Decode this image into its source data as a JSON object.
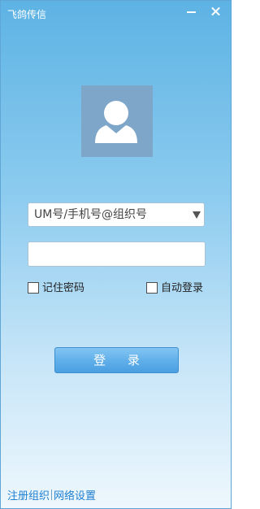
{
  "window": {
    "title": "飞鸽传信"
  },
  "login": {
    "account_placeholder": "UM号/手机号@组织号",
    "password_value": "",
    "remember_password_label": "记住密码",
    "remember_password_checked": false,
    "auto_login_label": "自动登录",
    "auto_login_checked": false,
    "login_button_label": "登 录"
  },
  "footer": {
    "register_link": "注册组织",
    "network_link": "网络设置"
  },
  "colors": {
    "gradient_top": "#5db3e4",
    "gradient_bottom": "#eef7fd",
    "avatar_bg": "#7ea6c9",
    "link": "#1f7fd0",
    "button": "#5eaee9"
  },
  "icons": {
    "minimize": "minimize-icon",
    "close": "close-icon",
    "avatar": "user-silhouette-icon",
    "dropdown": "triangle-down-icon"
  }
}
